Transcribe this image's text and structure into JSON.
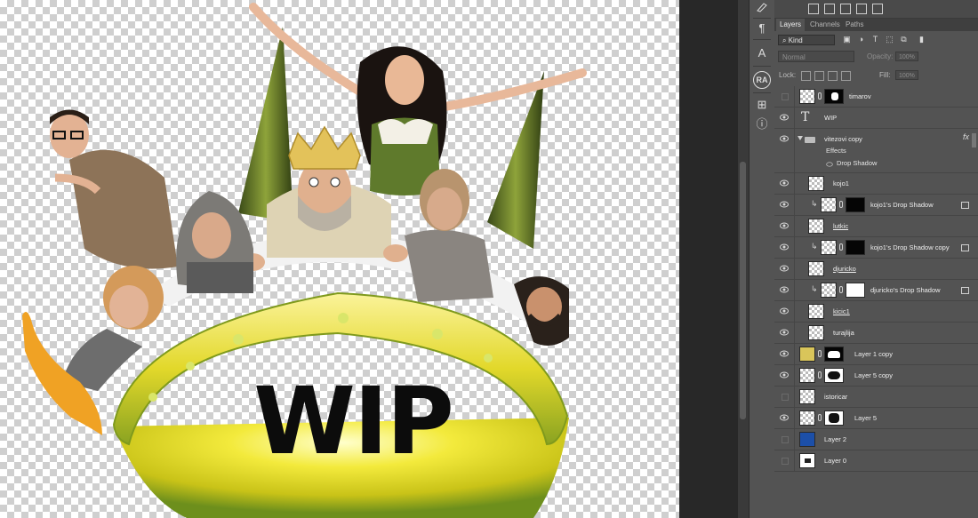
{
  "canvas": {
    "headline": "WIP"
  },
  "tools": [
    {
      "icon": "brush-preset-icon"
    },
    {
      "icon": "paragraph-icon",
      "glyph": "¶"
    },
    {
      "icon": "character-icon",
      "glyph": "A"
    },
    {
      "icon": "ra-badge-icon",
      "glyph": "RA"
    },
    {
      "icon": "properties-icon",
      "glyph": "⊞"
    },
    {
      "icon": "info-icon",
      "glyph": "ⓘ"
    }
  ],
  "panel": {
    "tabs": [
      "Layers",
      "Channels",
      "Paths"
    ],
    "active_tab": "Layers",
    "filter_kind": "Kind",
    "blend_mode": "Normal",
    "opacity_label": "Opacity:",
    "opacity_value": "100%",
    "lock_label": "Lock:",
    "fill_label": "Fill:",
    "fill_value": "100%",
    "layers": [
      {
        "name": "timarov",
        "visible": false
      },
      {
        "name": "WIP",
        "visible": true,
        "type": "text"
      },
      {
        "name": "vitezovi copy",
        "visible": true,
        "type": "group",
        "effects_label": "Effects",
        "effect": "Drop Shadow"
      },
      {
        "name": "kojo1",
        "visible": true
      },
      {
        "name": "kojo1's Drop Shadow",
        "visible": true
      },
      {
        "name": "lutkic",
        "visible": true
      },
      {
        "name": "kojo1's Drop Shadow copy",
        "visible": true
      },
      {
        "name": "djuricko",
        "visible": true
      },
      {
        "name": "djuricko's Drop Shadow",
        "visible": true
      },
      {
        "name": "kicic1",
        "visible": true
      },
      {
        "name": "turajlija",
        "visible": true
      },
      {
        "name": "Layer 1 copy",
        "visible": true
      },
      {
        "name": "Layer 5 copy",
        "visible": true
      },
      {
        "name": "istoricar",
        "visible": false
      },
      {
        "name": "Layer 5",
        "visible": true
      },
      {
        "name": "Layer 2",
        "visible": false
      },
      {
        "name": "Layer 0",
        "visible": false
      }
    ]
  },
  "colors": {
    "panel_bg": "#535353",
    "layer2_thumb": "#1c4fa8",
    "bowl_yellow": "#f1e63a",
    "bowl_green": "#5e8f1e"
  }
}
